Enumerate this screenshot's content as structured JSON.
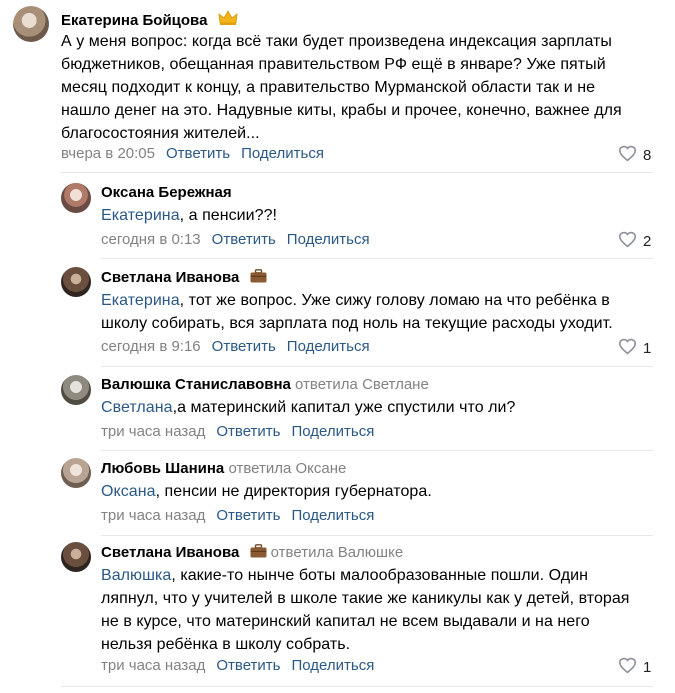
{
  "comments": [
    {
      "author": "Екатерина Бойцова",
      "reply_to": "",
      "mention": "",
      "text": "А у меня вопрос: когда всё таки будет произведена индексация зарплаты\nбюджетников, обещанная правительством РФ ещё в январе? Уже пятый\nмесяц подходит к концу, а правительство Мурманской области так и не\nнашло денег на это. Надувные киты, крабы и прочее, конечно, важнее для\nблагосостояния жителей...",
      "time": "вчера в 20:05",
      "reply_label": "Ответить",
      "share_label": "Поделиться",
      "likes": "8",
      "badge": "crown-icon"
    },
    {
      "author": "Оксана Бережная",
      "reply_to": "",
      "mention": "Екатерина",
      "text": ", а пенсии??!",
      "time": "сегодня в 0:13",
      "reply_label": "Ответить",
      "share_label": "Поделиться",
      "likes": "2"
    },
    {
      "author": "Светлана Иванова",
      "reply_to": "",
      "mention": "Екатерина",
      "text": ", тот же вопрос. Уже сижу голову ломаю на что ребёнка в\nшколу собирать, вся зарплата под ноль на текущие расходы уходит.",
      "time": "сегодня в 9:16",
      "reply_label": "Ответить",
      "share_label": "Поделиться",
      "likes": "1",
      "badge": "briefcase-icon"
    },
    {
      "author": "Валюшка Станиславовна",
      "reply_to": "ответила Светлане",
      "mention": "Светлана",
      "text": ",а материнский капитал уже спустили что ли?",
      "time": "три часа назад",
      "reply_label": "Ответить",
      "share_label": "Поделиться",
      "likes": ""
    },
    {
      "author": "Любовь Шанина",
      "reply_to": "ответила Оксане",
      "mention": "Оксана",
      "text": ", пенсии не директория губернатора.",
      "time": "три часа назад",
      "reply_label": "Ответить",
      "share_label": "Поделиться",
      "likes": ""
    },
    {
      "author": "Светлана Иванова",
      "reply_to": "ответила Валюшке",
      "mention": "Валюшка",
      "text": ", какие-то нынче боты малообразованные пошли. Один\nляпнул, что у учителей в школе такие же каникулы как у детей, вторая\nне в курсе, что материнский капитал не всем выдавали и на него\nнельзя ребёнка в школу собрать.",
      "time": "три часа назад",
      "reply_label": "Ответить",
      "share_label": "Поделиться",
      "likes": "1",
      "badge": "briefcase-icon"
    }
  ],
  "colors": {
    "link": "#2a5885",
    "secondary": "#828282",
    "separator": "#e7e8ec"
  }
}
